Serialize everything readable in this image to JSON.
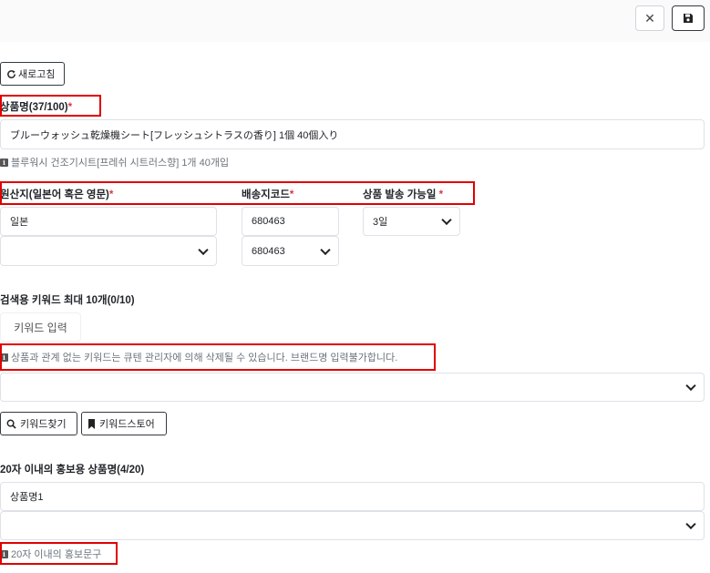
{
  "toolbar": {
    "close_icon": "close-icon",
    "save_icon": "floppy-disk-icon",
    "refresh_label": "새로고침",
    "refresh_icon": "refresh-icon"
  },
  "product_name": {
    "label": "상품명(37/100)",
    "required_mark": "*",
    "value": "ブルーウォッシュ乾燥機シート[フレッシュシトラスの香り] 1個 40個入り",
    "help": "블루워시 건조기시트[프레쉬 시트러스향] 1개 40개입"
  },
  "origin": {
    "label": "원산지(일본어 혹은 영문)",
    "required_mark": "*",
    "value": "일본",
    "select_value": ""
  },
  "shipping_code": {
    "label": "배송지코드",
    "required_mark": "*",
    "value": "680463",
    "select_value": "680463"
  },
  "ship_days": {
    "label": "상품 발송 가능일",
    "required_mark": "*",
    "value": "3일"
  },
  "keywords": {
    "label": "검색용 키워드 최대 10개(0/10)",
    "input_placeholder": "키워드 입력",
    "help": "상품과 관계 없는 키워드는 큐텐 관리자에 의해 삭제될 수 있습니다. 브랜드명 입력불가합니다.",
    "select_value": "",
    "find_label": "키워드찾기",
    "find_icon": "search-icon",
    "store_label": "키워드스토어",
    "store_icon": "bookmark-icon"
  },
  "promo": {
    "label": "20자 이내의 홍보용 상품명(4/20)",
    "value": "상품명1",
    "select_value": "",
    "help": "20자 이내의 홍보문구"
  },
  "colors": {
    "highlight": "#e00000",
    "required": "#dc3545",
    "help_text": "#6c757d"
  }
}
